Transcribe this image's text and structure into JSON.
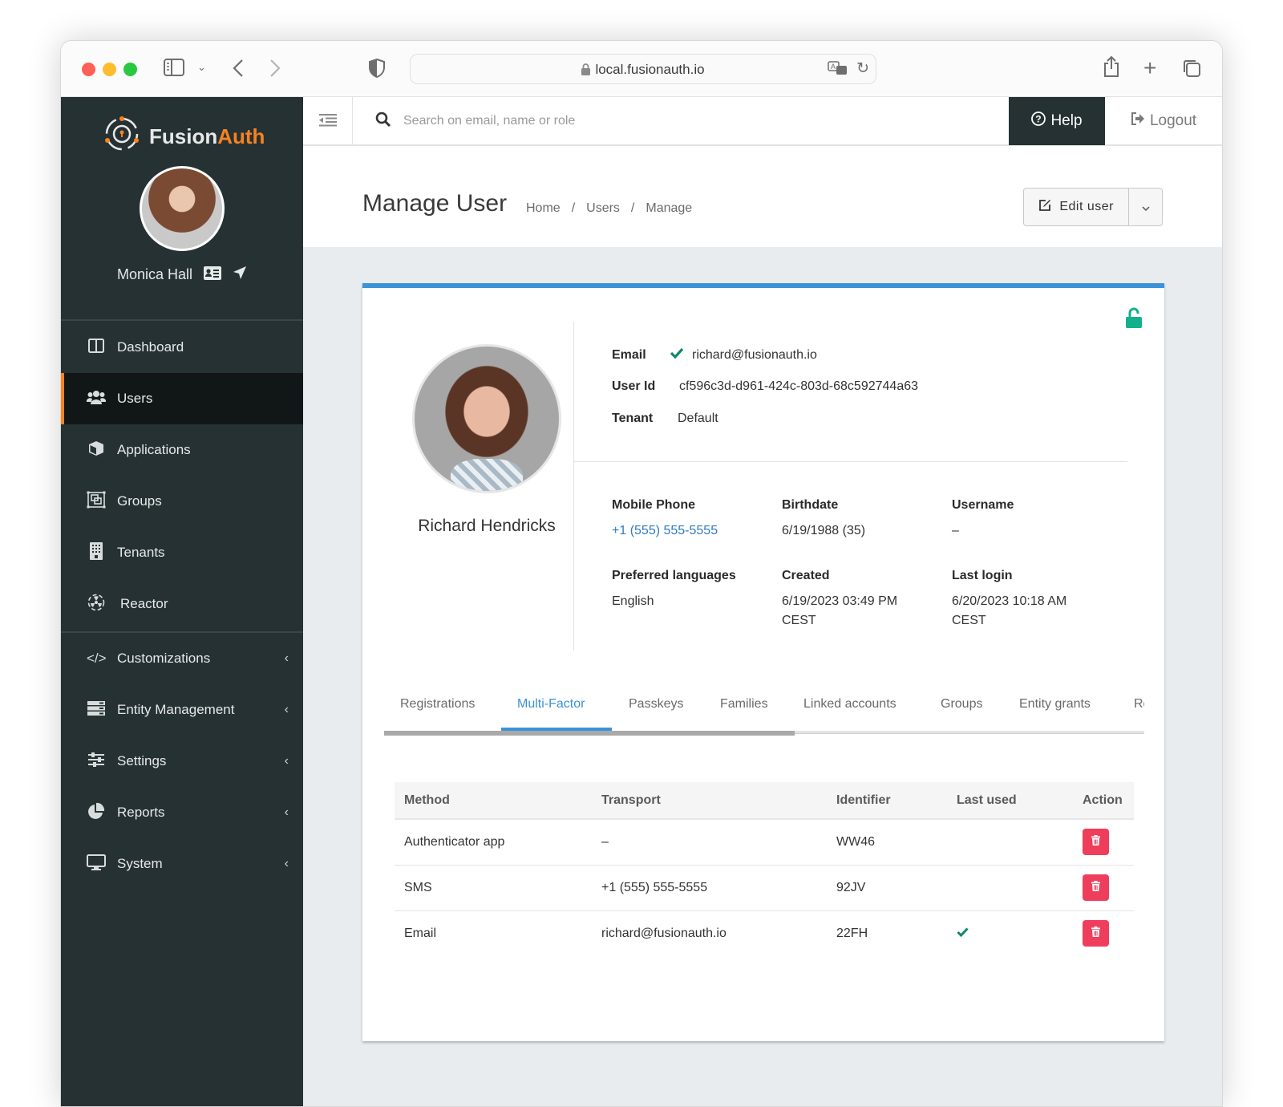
{
  "browser": {
    "url": "local.fusionauth.io"
  },
  "sidebar": {
    "brand_part1": "Fusion",
    "brand_part2": "Auth",
    "current_user": "Monica Hall",
    "items": [
      {
        "label": "Dashboard",
        "icon": "columns-icon",
        "expandable": false,
        "active": false
      },
      {
        "label": "Users",
        "icon": "users-icon",
        "expandable": false,
        "active": true
      },
      {
        "label": "Applications",
        "icon": "cube-icon",
        "expandable": false,
        "active": false
      },
      {
        "label": "Groups",
        "icon": "object-group-icon",
        "expandable": false,
        "active": false
      },
      {
        "label": "Tenants",
        "icon": "building-icon",
        "expandable": false,
        "active": false
      },
      {
        "label": "Reactor",
        "icon": "reactor-icon",
        "expandable": false,
        "active": false
      },
      {
        "label": "Customizations",
        "icon": "code-icon",
        "expandable": true,
        "active": false
      },
      {
        "label": "Entity Management",
        "icon": "server-icon",
        "expandable": true,
        "active": false
      },
      {
        "label": "Settings",
        "icon": "sliders-icon",
        "expandable": true,
        "active": false
      },
      {
        "label": "Reports",
        "icon": "pie-chart-icon",
        "expandable": true,
        "active": false
      },
      {
        "label": "System",
        "icon": "desktop-icon",
        "expandable": true,
        "active": false
      }
    ]
  },
  "topbar": {
    "search_placeholder": "Search on email, name or role",
    "help_label": "Help",
    "logout_label": "Logout"
  },
  "header": {
    "title": "Manage User",
    "breadcrumb": [
      "Home",
      "Users",
      "Manage"
    ],
    "edit_label": "Edit user"
  },
  "user": {
    "name": "Richard Hendricks",
    "email_label": "Email",
    "email": "richard@fusionauth.io",
    "email_verified": true,
    "userid_label": "User Id",
    "userid": "cf596c3d-d961-424c-803d-68c592744a63",
    "tenant_label": "Tenant",
    "tenant": "Default",
    "fields": [
      {
        "label": "Mobile Phone",
        "value": "+1 (555) 555-5555",
        "link": true
      },
      {
        "label": "Birthdate",
        "value": "6/19/1988 (35)",
        "link": false
      },
      {
        "label": "Username",
        "value": "–",
        "link": false
      },
      {
        "label": "Preferred languages",
        "value": "English",
        "link": false
      },
      {
        "label": "Created",
        "value": "6/19/2023 03:49 PM",
        "value2": "CEST",
        "link": false
      },
      {
        "label": "Last login",
        "value": "6/20/2023 10:18 AM",
        "value2": "CEST",
        "link": false
      }
    ],
    "account_status_color": "#13b08c"
  },
  "tabs": [
    {
      "label": "Registrations",
      "active": false
    },
    {
      "label": "Multi-Factor",
      "active": true
    },
    {
      "label": "Passkeys",
      "active": false
    },
    {
      "label": "Families",
      "active": false
    },
    {
      "label": "Linked accounts",
      "active": false
    },
    {
      "label": "Groups",
      "active": false
    },
    {
      "label": "Entity grants",
      "active": false
    },
    {
      "label": "Re",
      "active": false
    }
  ],
  "mfa": {
    "columns": [
      "Method",
      "Transport",
      "Identifier",
      "Last used",
      "Action"
    ],
    "rows": [
      {
        "method": "Authenticator app",
        "transport": "–",
        "identifier": "WW46",
        "last_used": false
      },
      {
        "method": "SMS",
        "transport": "+1 (555) 555-5555",
        "identifier": "92JV",
        "last_used": false
      },
      {
        "method": "Email",
        "transport": "richard@fusionauth.io",
        "identifier": "22FH",
        "last_used": true
      }
    ]
  },
  "colors": {
    "accent": "#3a92d9",
    "brand_orange": "#f58320",
    "sidebar_bg": "#263133",
    "danger": "#ef3e5c",
    "success": "#13866f"
  }
}
